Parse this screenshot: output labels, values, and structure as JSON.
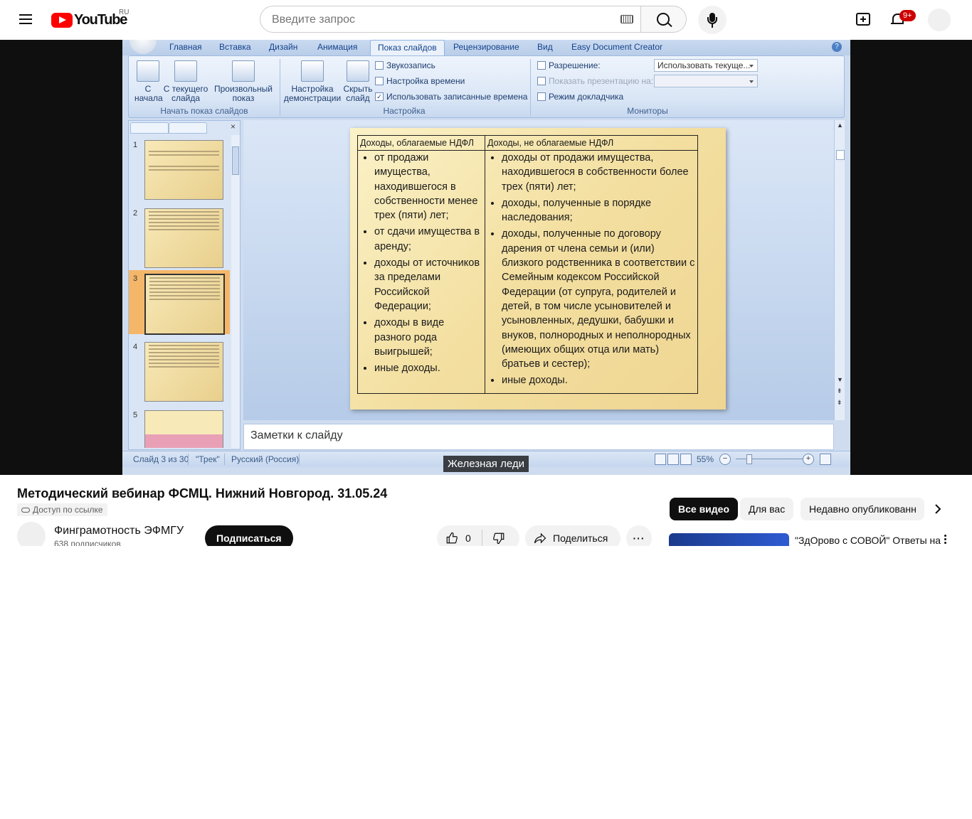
{
  "masthead": {
    "logo_text": "YouTube",
    "country_code": "RU",
    "search_placeholder": "Введите запрос",
    "notifications_badge": "9+"
  },
  "ppt": {
    "tabs": [
      "Главная",
      "Вставка",
      "Дизайн",
      "Анимация",
      "Показ слайдов",
      "Рецензирование",
      "Вид",
      "Easy Document Creator"
    ],
    "active_tab": "Показ слайдов",
    "groups": {
      "start": {
        "label": "Начать показ слайдов",
        "buttons": [
          "С начала",
          "С текущего слайда",
          "Произвольный показ"
        ]
      },
      "setup": {
        "label": "Настройка",
        "buttons": [
          "Настройка демонстрации",
          "Скрыть слайд"
        ],
        "small": [
          "Звукозапись",
          "Настройка времени",
          "Использовать записанные времена"
        ]
      },
      "monitors": {
        "label": "Мониторы",
        "resolution_label": "Разрешение:",
        "resolution_value": "Использовать текуще...",
        "show_on_label": "Показать презентацию на:",
        "presenter_view": "Режим докладчика"
      }
    },
    "thumbnail_numbers": [
      "1",
      "2",
      "3",
      "4",
      "5"
    ],
    "selected_slide": 3,
    "slide_table": {
      "headers": [
        "Доходы, облагаемые НДФЛ",
        "Доходы, не облагаемые НДФЛ"
      ],
      "left": [
        "от продажи имущества, находившегося в собственности менее трех (пяти) лет;",
        "от сдачи имущества в аренду;",
        "доходы от источников за пределами Российской Федерации;",
        "доходы в виде разного рода выигрышей;",
        "иные доходы."
      ],
      "right": [
        "доходы от продажи имущества, находившегося в собственности более трех (пяти) лет;",
        "доходы, полученные в порядке наследования;",
        "доходы, полученные по договору дарения от члена семьи и (или) близкого родственника в соответствии с Семейным кодексом Российской Федерации (от супруга, родителей и детей, в том числе усыновителей и усыновленных, дедушки, бабушки и внуков, полнородных и неполнородных (имеющих общих отца или мать) братьев и сестер);",
        "иные доходы."
      ]
    },
    "notes_placeholder": "Заметки к слайду",
    "status": {
      "slide": "Слайд 3 из 30",
      "theme": "\"Трек\"",
      "language": "Русский (Россия)",
      "zoom": "55%"
    }
  },
  "caption": "Железная леди",
  "video": {
    "title": "Методический вебинар ФСМЦ. Нижний Новгород. 31.05.24",
    "access": "Доступ по ссылке",
    "channel_name": "Финграмотность ЭФМГУ",
    "subscribers": "638 подписчиков",
    "subscribe_label": "Подписаться",
    "likes": "0",
    "share_label": "Поделиться"
  },
  "chips": [
    "Все видео",
    "Для вас",
    "Недавно опубликованн"
  ],
  "recommendation": {
    "title": "\"ЗдОрово с СОВОЙ\" Ответы на"
  }
}
